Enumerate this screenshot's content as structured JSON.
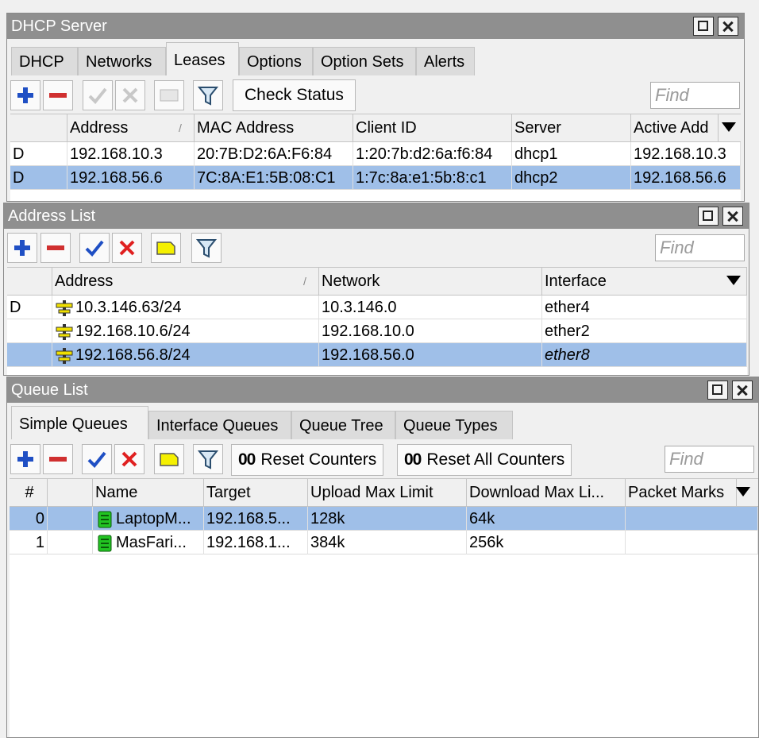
{
  "dhcp": {
    "title": "DHCP Server",
    "tabs": [
      "DHCP",
      "Networks",
      "Leases",
      "Options",
      "Option Sets",
      "Alerts"
    ],
    "active_tab": "Leases",
    "check_status": "Check Status",
    "find_placeholder": "Find",
    "columns": [
      "",
      "Address",
      "MAC Address",
      "Client ID",
      "Server",
      "Active Add"
    ],
    "rows": [
      {
        "flag": "D",
        "address": "192.168.10.3",
        "mac": "20:7B:D2:6A:F6:84",
        "client_id": "1:20:7b:d2:6a:f6:84",
        "server": "dhcp1",
        "active": "192.168.10.3"
      },
      {
        "flag": "D",
        "address": "192.168.56.6",
        "mac": "7C:8A:E1:5B:08:C1",
        "client_id": "1:7c:8a:e1:5b:8:c1",
        "server": "dhcp2",
        "active": "192.168.56.6"
      }
    ]
  },
  "address_list": {
    "title": "Address List",
    "find_placeholder": "Find",
    "columns": [
      "",
      "Address",
      "Network",
      "Interface"
    ],
    "rows": [
      {
        "flag": "D",
        "address": "10.3.146.63/24",
        "network": "10.3.146.0",
        "interface": "ether4"
      },
      {
        "flag": "",
        "address": "192.168.10.6/24",
        "network": "192.168.10.0",
        "interface": "ether2"
      },
      {
        "flag": "",
        "address": "192.168.56.8/24",
        "network": "192.168.56.0",
        "interface": "ether8"
      }
    ]
  },
  "queue": {
    "title": "Queue List",
    "tabs": [
      "Simple Queues",
      "Interface Queues",
      "Queue Tree",
      "Queue Types"
    ],
    "active_tab": "Simple Queues",
    "reset_counters_icon": "00",
    "reset_counters": "Reset Counters",
    "reset_all_counters": "Reset All Counters",
    "find_placeholder": "Find",
    "columns": [
      "#",
      "",
      "Name",
      "Target",
      "Upload Max Limit",
      "Download Max Li...",
      "Packet Marks"
    ],
    "rows": [
      {
        "num": "0",
        "name": "LaptopM...",
        "target": "192.168.5...",
        "upload": "128k",
        "download": "64k"
      },
      {
        "num": "1",
        "name": "MasFari...",
        "target": "192.168.1...",
        "upload": "384k",
        "download": "256k"
      }
    ]
  },
  "colors": {
    "selection": "#9fbfe8",
    "titlebar": "#8f8f8f",
    "add_blue": "#1f4fc4",
    "remove_red": "#d03030"
  },
  "icons": [
    "add-icon",
    "remove-icon",
    "enable-icon",
    "disable-icon",
    "comment-icon",
    "filter-icon",
    "ip-address-icon",
    "queue-icon",
    "maximize-icon",
    "close-icon"
  ]
}
